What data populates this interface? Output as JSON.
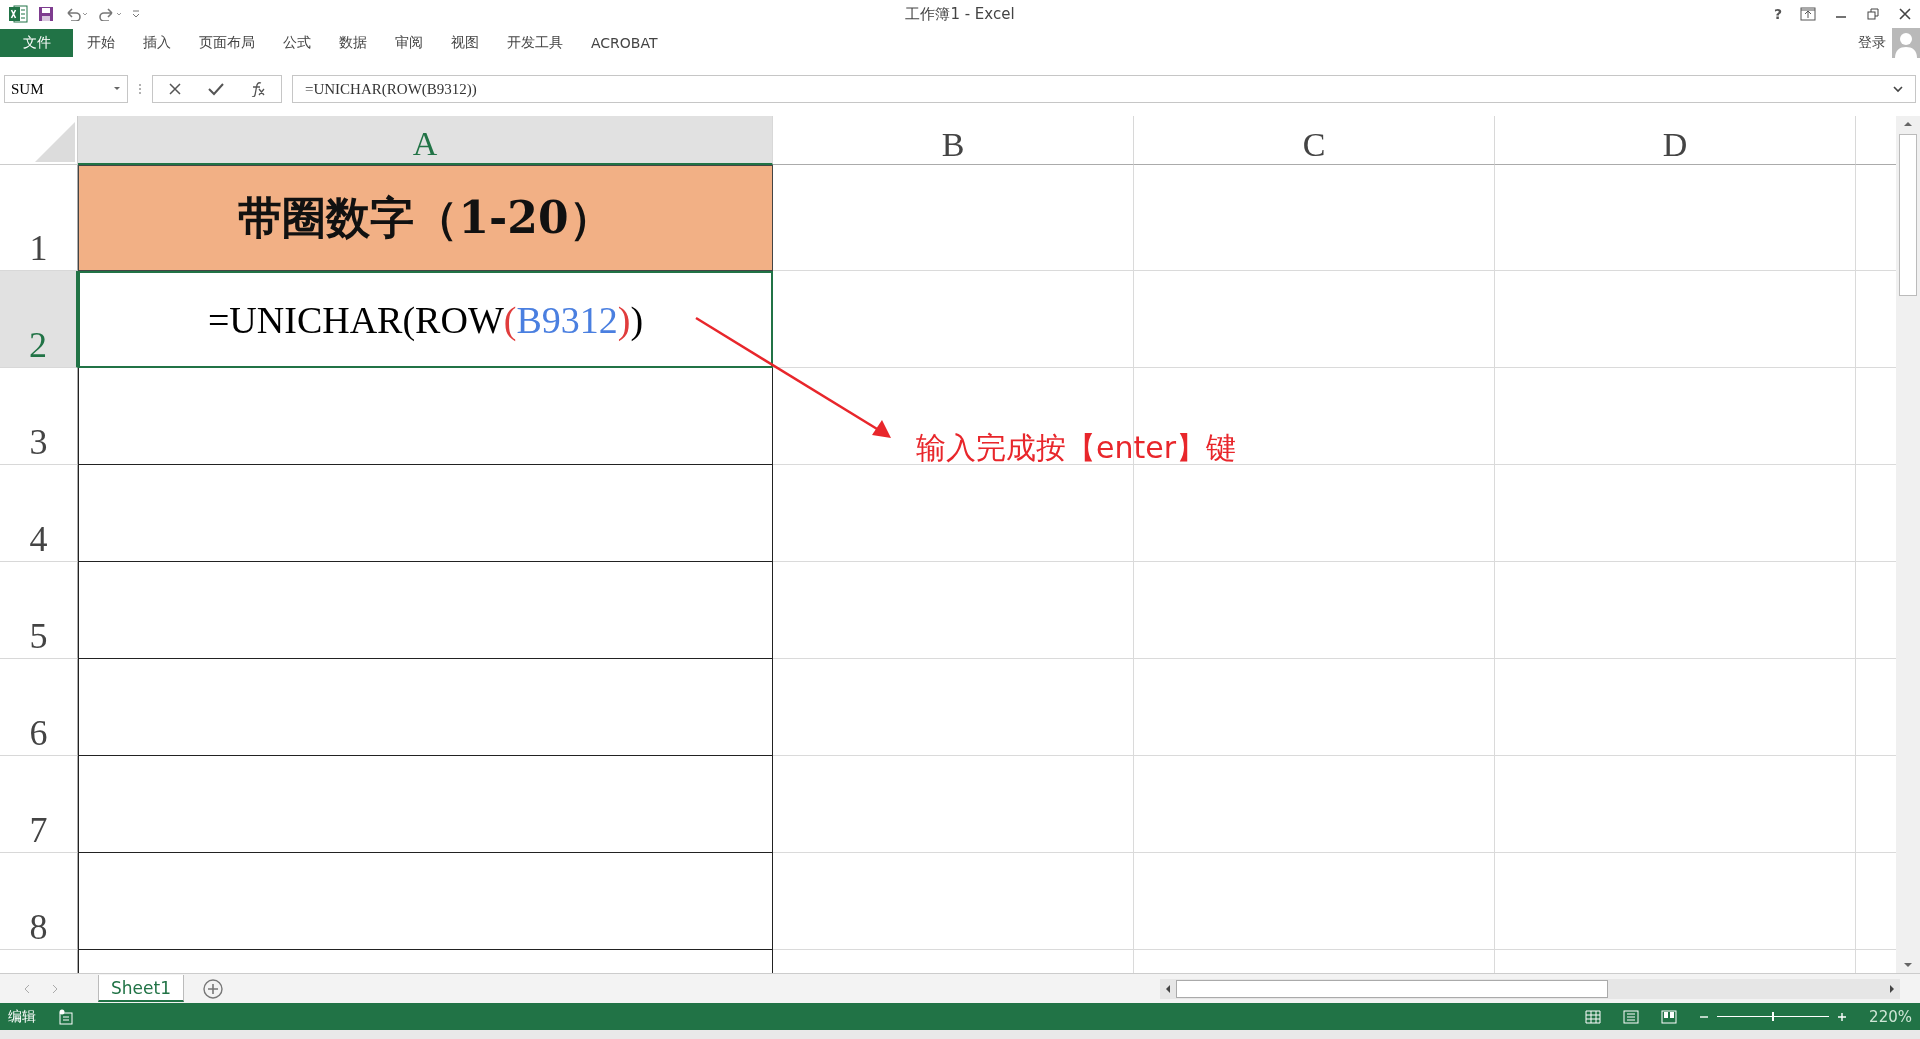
{
  "window": {
    "title": "工作簿1 - Excel",
    "help": "?"
  },
  "ribbon": {
    "file_tab": "文件",
    "tabs": [
      {
        "label": "开始",
        "selected": false
      },
      {
        "label": "插入",
        "selected": false
      },
      {
        "label": "页面布局",
        "selected": false
      },
      {
        "label": "公式",
        "selected": false
      },
      {
        "label": "数据",
        "selected": false
      },
      {
        "label": "审阅",
        "selected": false
      },
      {
        "label": "视图",
        "selected": false
      },
      {
        "label": "开发工具",
        "selected": false
      },
      {
        "label": "ACROBAT",
        "selected": false
      }
    ],
    "sign_in": "登录"
  },
  "formula_bar": {
    "name_box": "SUM",
    "formula": "=UNICHAR(ROW(B9312))"
  },
  "sheet": {
    "columns": [
      {
        "label": "A",
        "selected": true
      },
      {
        "label": "B",
        "selected": false
      },
      {
        "label": "C",
        "selected": false
      },
      {
        "label": "D",
        "selected": false
      }
    ],
    "rows": [
      {
        "label": "1",
        "selected": false
      },
      {
        "label": "2",
        "selected": true
      },
      {
        "label": "3",
        "selected": false
      },
      {
        "label": "4",
        "selected": false
      },
      {
        "label": "5",
        "selected": false
      },
      {
        "label": "6",
        "selected": false
      },
      {
        "label": "7",
        "selected": false
      },
      {
        "label": "8",
        "selected": false
      }
    ],
    "title_cell": "带圈数字（1-20）",
    "formula_cell": [
      {
        "text": "=UNICHAR(ROW",
        "color": "#000000"
      },
      {
        "text": "(",
        "color": "#e03c3c"
      },
      {
        "text": "B9312",
        "color": "#4a7fe0"
      },
      {
        "text": ")",
        "color": "#e03c3c"
      },
      {
        "text": ")",
        "color": "#000000"
      }
    ]
  },
  "annotation": {
    "text": "输入完成按【enter】键"
  },
  "sheet_tabs": [
    {
      "label": "Sheet1",
      "selected": true
    }
  ],
  "status_bar": {
    "mode": "编辑",
    "zoom": "220%",
    "zoom_slider": {
      "level": 0.5
    }
  }
}
